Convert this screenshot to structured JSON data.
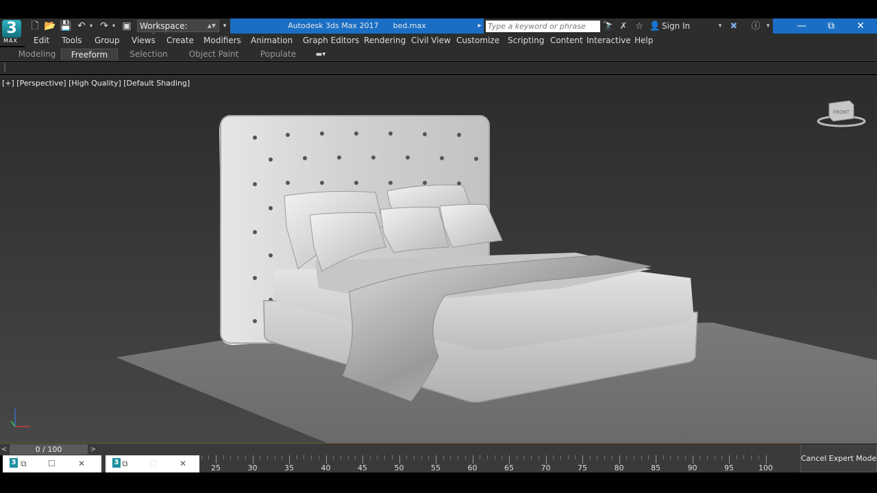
{
  "app": {
    "title": "Autodesk 3ds Max 2017",
    "file": "bed.max",
    "logo_text": "MAX",
    "logo_number": "3"
  },
  "quickaccess": {
    "workspace_label": "Workspace: Default"
  },
  "search": {
    "placeholder": "Type a keyword or phrase"
  },
  "account": {
    "sign_in": "Sign In"
  },
  "window_controls": {
    "minimize": "—",
    "restore": "⧉",
    "close": "✕"
  },
  "menu": {
    "items": [
      "Edit",
      "Tools",
      "Group",
      "Views",
      "Create",
      "Modifiers",
      "Animation",
      "Graph Editors",
      "Rendering",
      "Civil View",
      "Customize",
      "Scripting",
      "Content",
      "Interactive",
      "Help"
    ]
  },
  "ribbon": {
    "tabs": [
      "Modeling",
      "Freeform",
      "Selection",
      "Object Paint",
      "Populate"
    ],
    "active": "Freeform"
  },
  "viewport": {
    "label": "[+] [Perspective] [High Quality] [Default Shading]"
  },
  "timeline": {
    "slider_label": "0 / 100",
    "prev": "<",
    "next": ">",
    "ticks": [
      "25",
      "30",
      "35",
      "40",
      "45",
      "50",
      "55",
      "60",
      "65",
      "70",
      "75",
      "80",
      "85",
      "90",
      "95",
      "100"
    ]
  },
  "status": {
    "expert_mode_button": "Cancel Expert Mode"
  },
  "colors": {
    "titlebar": "#1a6fc4",
    "panel": "#2d2d2d",
    "viewport_bg": "#3a3a3a"
  }
}
